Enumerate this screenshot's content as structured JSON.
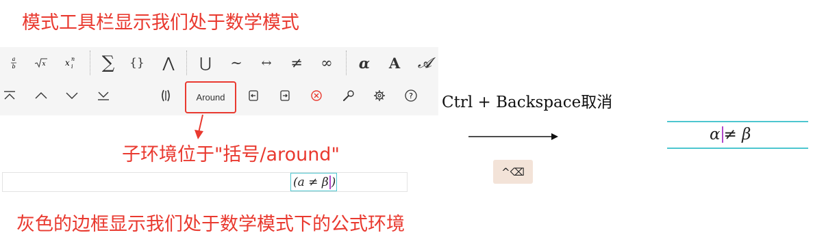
{
  "annotations": {
    "top": "模式工具栏显示我们处于数学模式",
    "middle": "子环境位于\"括号/around\"",
    "bottom": "灰色的边框显示我们处于数学模式下的公式环境"
  },
  "toolbar": {
    "row1": [
      {
        "name": "fraction-button",
        "icon": "fraction-icon"
      },
      {
        "name": "sqrt-button",
        "icon": "sqrt-icon"
      },
      {
        "name": "subsup-button",
        "icon": "subsup-icon"
      },
      {
        "name": "sum-button",
        "label": "∑"
      },
      {
        "name": "braces-button",
        "label": "{}"
      },
      {
        "name": "wedge-button",
        "label": "⋀"
      },
      {
        "name": "union-button",
        "label": "⋃"
      },
      {
        "name": "tilde-button",
        "label": "∼"
      },
      {
        "name": "leftrightarrow-button",
        "label": "↔"
      },
      {
        "name": "neq-button",
        "label": "≠"
      },
      {
        "name": "infinity-button",
        "label": "∞"
      },
      {
        "name": "greek-alpha-button",
        "label": "α"
      },
      {
        "name": "bold-a-button",
        "label": "A"
      },
      {
        "name": "script-a-button",
        "label": "𝓐"
      }
    ],
    "row2": {
      "around_label": "Around"
    },
    "icons": {
      "overline": "overline-bar-icon",
      "caret-up": "chevron-up-icon",
      "caret-down": "chevron-down-icon",
      "underline": "underline-chevron-icon",
      "paren": "paren-icon",
      "enter-left": "enter-left-icon",
      "exit-right": "exit-right-icon",
      "delete": "delete-x-icon",
      "wrench": "wrench-icon",
      "gear": "gear-icon",
      "help": "help-icon"
    }
  },
  "editor": {
    "formula_left": "(a ≠ β",
    "formula_right": ")"
  },
  "shortcut": {
    "label": "Ctrl + Backspace取消",
    "key": "^⌫"
  },
  "result": {
    "formula_alpha": "α",
    "formula_rest": "≠ β"
  },
  "colors": {
    "accent_red": "#e9392f",
    "cyan": "#4cc6cf",
    "caret_purple": "#b047c9"
  }
}
